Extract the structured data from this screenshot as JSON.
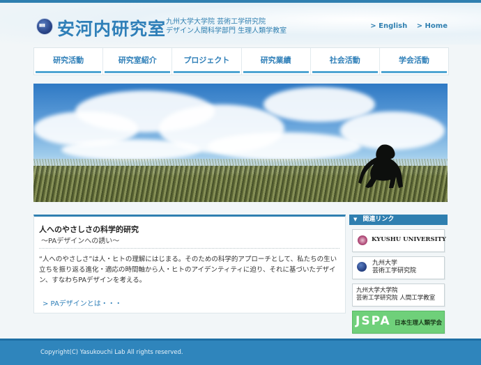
{
  "header": {
    "title": "安河内研究室",
    "dept_line1": "九州大学大学院  芸術工学研究院",
    "dept_line2": "デザイン人間科学部門  生理人類学教室",
    "links": [
      "> English",
      "> Home"
    ]
  },
  "nav": {
    "items": [
      "研究活動",
      "研究室紹介",
      "プロジェクト",
      "研究業績",
      "社会活動",
      "学会活動"
    ]
  },
  "main": {
    "title": "人へのやさしさの科学的研究",
    "subtitle": "～PAデザインへの誘い～",
    "body": "“人へのやさしさ”は人・ヒトの理解にはじまる。そのための科学的アプローチとして、私たちの生い立ちを振り返る進化・適応の時間軸から人・ヒトのアイデンティティに迫り、それに基づいたデザイン、すなわちPAデザインを考える。",
    "link": "> PAデザインとは・・・"
  },
  "sidebar": {
    "header": "関連リンク",
    "banners": {
      "kyushu": "KYUSHU UNIVERSITY",
      "design_line1": "九州大学",
      "design_line2": "芸術工学研究院",
      "ergo_line1": "九州大学大学院",
      "ergo_line2": "芸術工学研究院 人間工学教室",
      "jspa_logo": "JSPA",
      "jspa_name": "日本生理人類学会"
    }
  },
  "footer": {
    "copyright": "Copyright(C) Yasukouchi Lab All rights reserved."
  }
}
